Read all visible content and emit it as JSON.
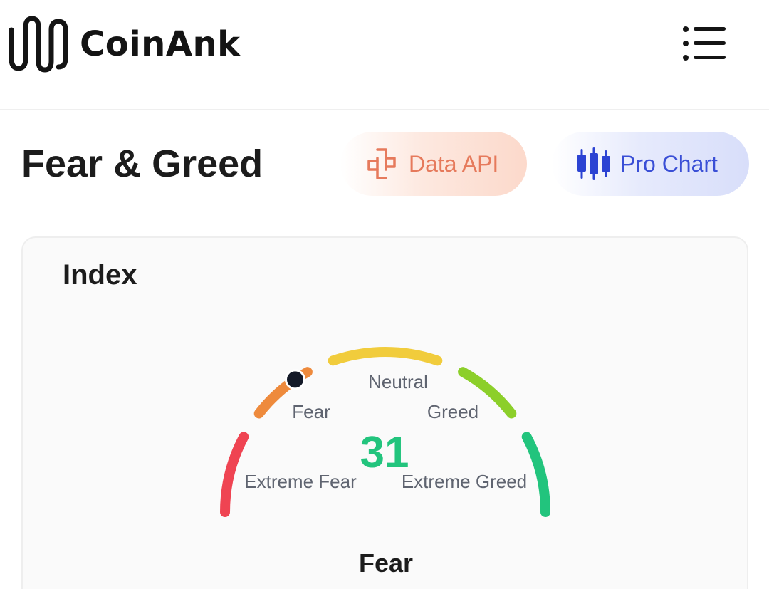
{
  "header": {
    "brand": "CoinAnk",
    "logo_icon": "coinank-wave-icon",
    "menu_icon": "menu-list-icon"
  },
  "page": {
    "title": "Fear & Greed"
  },
  "actions": {
    "data_api": {
      "label": "Data API",
      "icon": "api-plug-icon",
      "color": "#e67a5c"
    },
    "pro_chart": {
      "label": "Pro Chart",
      "icon": "candlestick-icon",
      "color": "#3a4fd6"
    }
  },
  "index_card": {
    "title": "Index",
    "gauge": {
      "value": "31",
      "value_number": 31,
      "min": 0,
      "max": 100,
      "classification": "Fear",
      "value_color": "#22c47d",
      "zones": [
        {
          "label": "Extreme Fear",
          "color": "#ef4452"
        },
        {
          "label": "Fear",
          "color": "#ee8a3c"
        },
        {
          "label": "Neutral",
          "color": "#f1cc3c"
        },
        {
          "label": "Greed",
          "color": "#8ccf2a"
        },
        {
          "label": "Extreme Greed",
          "color": "#22c47d"
        }
      ]
    }
  }
}
